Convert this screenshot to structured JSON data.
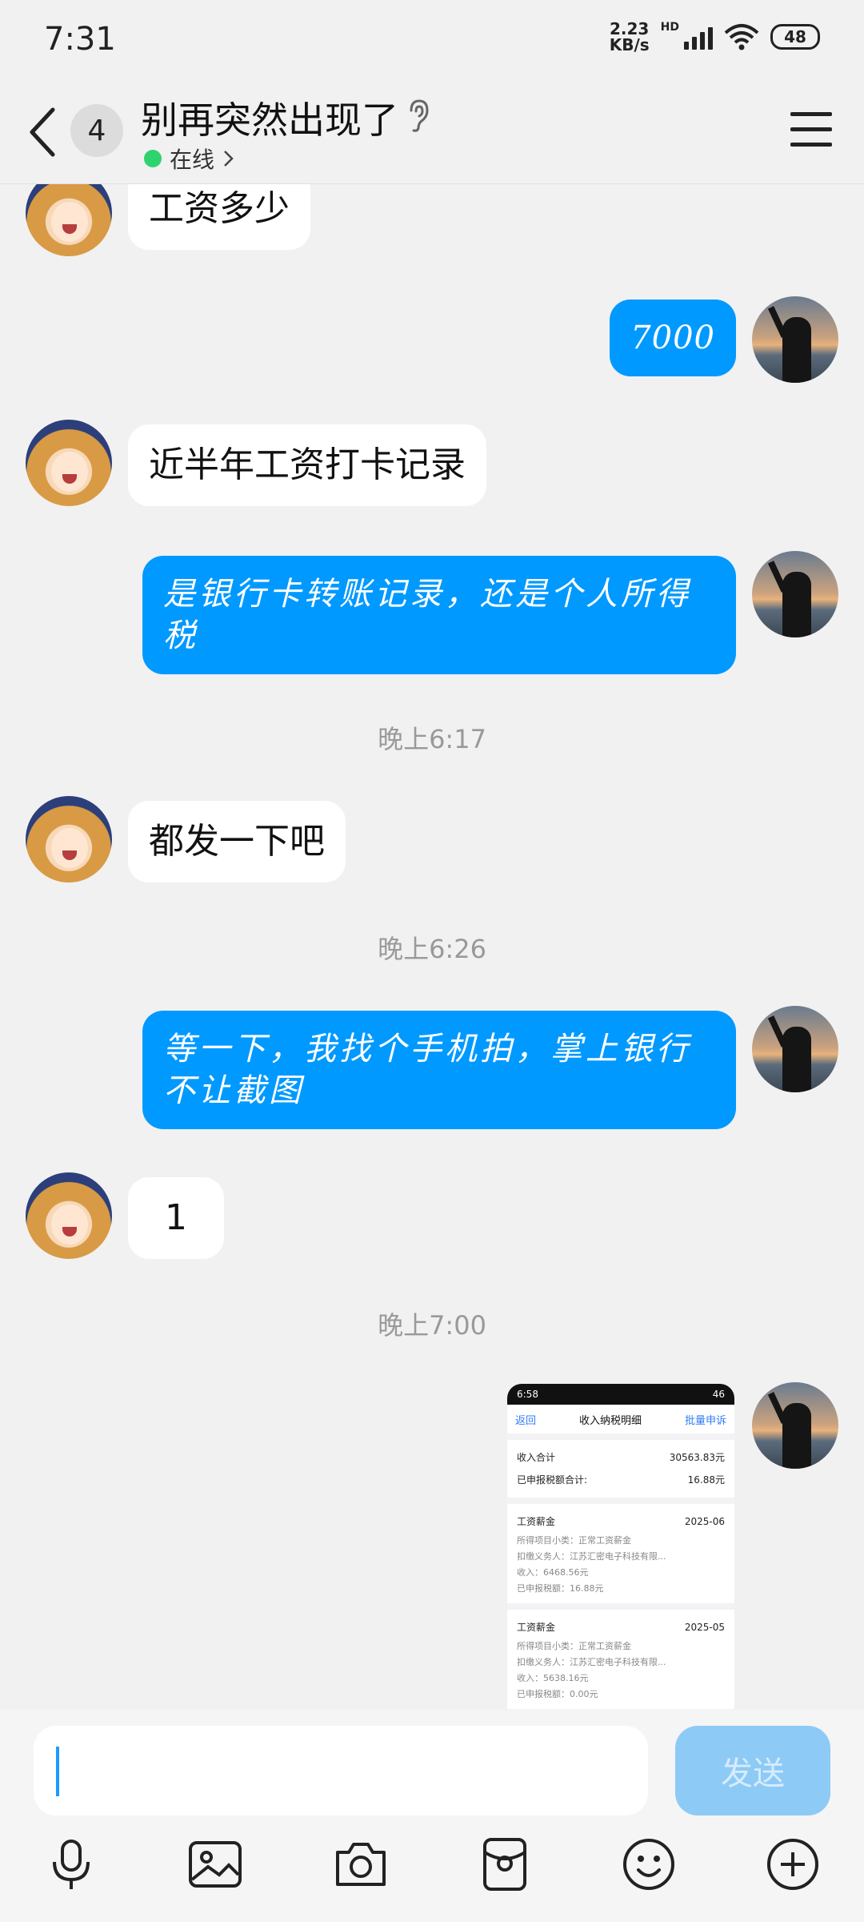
{
  "status_bar": {
    "time": "7:31",
    "net_speed_value": "2.23",
    "net_speed_unit": "KB/s",
    "hd": "HD",
    "battery": "48"
  },
  "header": {
    "unread_count": "4",
    "title": "别再突然出现了",
    "presence": "在线"
  },
  "messages": [
    {
      "side": "in",
      "text": "工资多少"
    },
    {
      "side": "out",
      "text": "7000"
    },
    {
      "side": "in",
      "text": "近半年工资打卡记录"
    },
    {
      "side": "out",
      "text": "是银行卡转账记录，还是个人所得税"
    },
    {
      "time": "晚上6:17"
    },
    {
      "side": "in",
      "text": "都发一下吧"
    },
    {
      "time": "晚上6:26"
    },
    {
      "side": "out",
      "text": "等一下，我找个手机拍，掌上银行不让截图"
    },
    {
      "side": "in",
      "text": "1"
    },
    {
      "time": "晚上7:00"
    }
  ],
  "shared_image": {
    "status_time": "6:58",
    "status_right": "46",
    "back": "返回",
    "title": "收入纳税明细",
    "action": "批量申诉",
    "summary": {
      "income_label": "收入合计",
      "income_value": "30563.83元",
      "tax_label": "已申报税额合计:",
      "tax_value": "16.88元"
    },
    "records": [
      {
        "name": "工资薪金",
        "period": "2025-06",
        "item": "所得项目小类：正常工资薪金",
        "payer": "扣缴义务人：江苏汇密电子科技有限...",
        "income": "收入：6468.56元",
        "tax": "已申报税额：16.88元"
      },
      {
        "name": "工资薪金",
        "period": "2025-05",
        "item": "所得项目小类：正常工资薪金",
        "payer": "扣缴义务人：江苏汇密电子科技有限...",
        "income": "收入：5638.16元",
        "tax": "已申报税额：0.00元"
      }
    ]
  },
  "input_bar": {
    "send_label": "发送"
  },
  "colors": {
    "outgoing_bubble": "#0099ff",
    "online_dot": "#2fd36d",
    "send_disabled": "#8ecaf6"
  },
  "icons": [
    "back-arrow-icon",
    "ear-icon",
    "menu-icon",
    "microphone-icon",
    "image-icon",
    "camera-icon",
    "red-packet-icon",
    "emoji-icon",
    "plus-icon"
  ]
}
